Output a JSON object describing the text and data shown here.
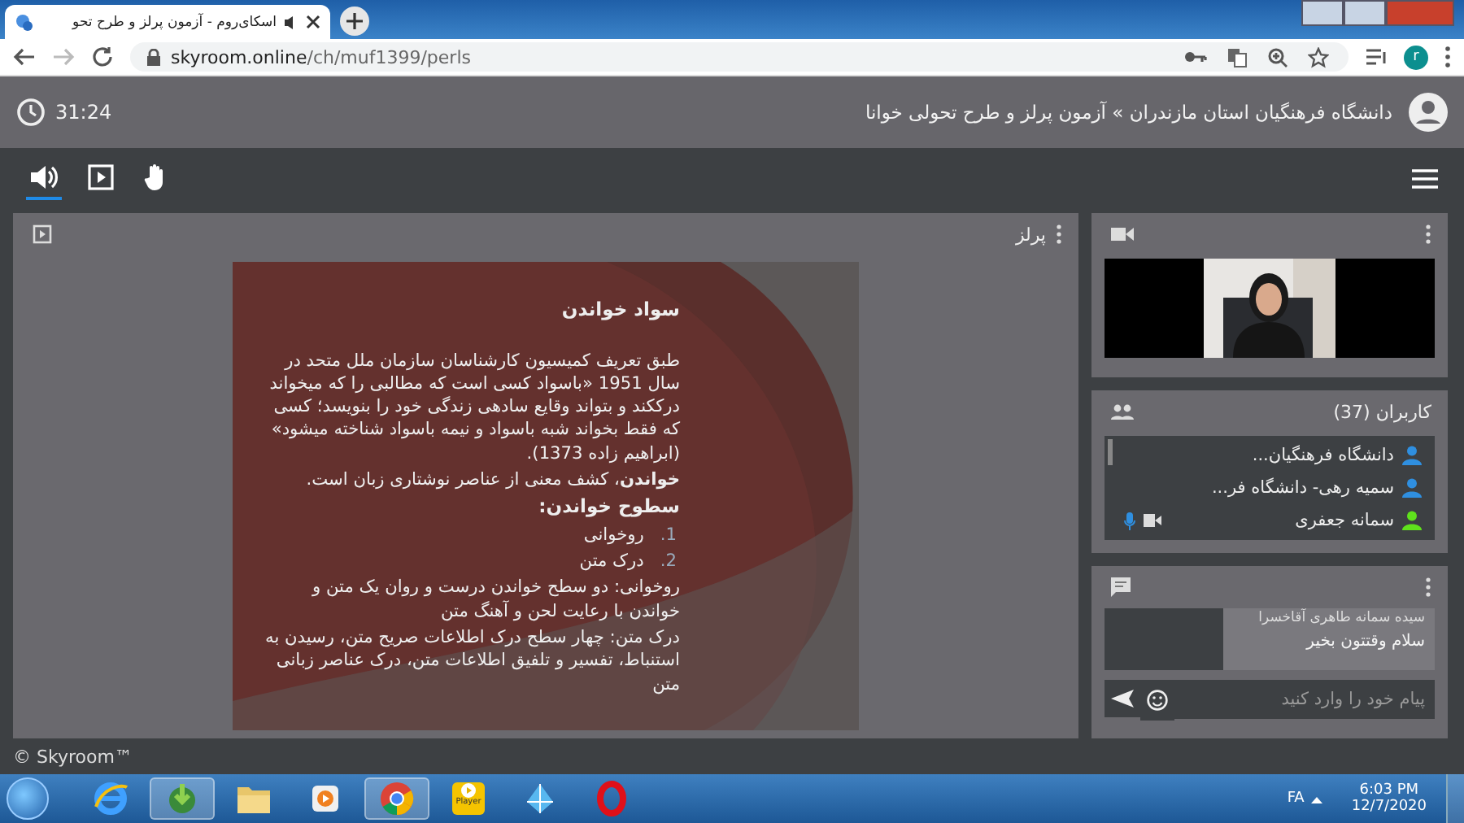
{
  "browser": {
    "tab_title": "اسکای‌روم - آزمون پرلز و طرح تحو",
    "address_host": "skyroom.online",
    "address_path": "/ch/muf1399/perls",
    "profile_initial": "r"
  },
  "header": {
    "timer": "31:24",
    "breadcrumb": "دانشگاه فرهنگیان استان مازندران » آزمون پرلز و طرح تحولی خوانا"
  },
  "toolbar": [
    {
      "kind": "audio",
      "selected": true
    },
    {
      "kind": "presentation",
      "selected": false
    },
    {
      "kind": "hand",
      "selected": false
    }
  ],
  "presentation": {
    "title": "پرلز",
    "slide": {
      "heading": "سواد خواندن",
      "blocks": [
        {
          "kind": "para",
          "text": "طبق تعریف کمیسیون کارشناسان سازمان ملل متحد در سال 1951 «باسواد کسی است که مطالبی را که میخواند درککند و بتواند وقایع سادهی زندگی خود را بنویسد؛ کسی که فقط بخواند شبه باسواد و نیمه باسواد شناخته میشود» (ابراهیم زاده 1373)."
        },
        {
          "kind": "para",
          "text": "**خواندن**، کشف معنی از عناصر نوشتاری زبان است."
        },
        {
          "kind": "subheading",
          "text": "سطوح خواندن:"
        },
        {
          "kind": "item",
          "number": "1.",
          "text": "روخوانی"
        },
        {
          "kind": "item",
          "number": "2.",
          "text": "درک متن"
        },
        {
          "kind": "para",
          "text": "روخوانی: دو سطح خواندن درست و روان یک متن و خواندن با رعایت لحن و آهنگ متن"
        },
        {
          "kind": "para",
          "text": "درک متن: چهار سطح درک اطلاعات صریح متن، رسیدن به استنباط، تفسیر و تلفیق اطلاعات متن، درک عناصر زبانی متن"
        }
      ]
    }
  },
  "users": {
    "title": "کاربران (37)",
    "items": [
      {
        "name": "دانشگاه فرهنگیان...",
        "color": "#2f8fe0",
        "mic": false,
        "camera": false
      },
      {
        "name": "سمیه رهی- دانشگاه فر...",
        "color": "#2f8fe0",
        "mic": false,
        "camera": false
      },
      {
        "name": "سمانه جعفری",
        "color": "#5fe11c",
        "mic": true,
        "camera": true
      }
    ]
  },
  "chat": {
    "messages": [
      {
        "sender": "سیده سمانه طاهری آقاخسرا",
        "text": "سلام وقتتون بخیر"
      }
    ],
    "input": {
      "placeholder": "پیام خود را وارد کنید"
    }
  },
  "footer": "© Skyroom™",
  "taskbar": {
    "apps": [
      {
        "kind": "ie",
        "active": false
      },
      {
        "kind": "downloader",
        "active": true
      },
      {
        "kind": "folder",
        "active": false
      },
      {
        "kind": "media",
        "active": false
      },
      {
        "kind": "chrome",
        "active": true
      },
      {
        "kind": "player",
        "label": "Player",
        "active": false
      },
      {
        "kind": "kite",
        "active": false
      },
      {
        "kind": "opera",
        "active": false
      }
    ],
    "language": "FA",
    "time": "6:03 PM",
    "date": "12/7/2020"
  }
}
